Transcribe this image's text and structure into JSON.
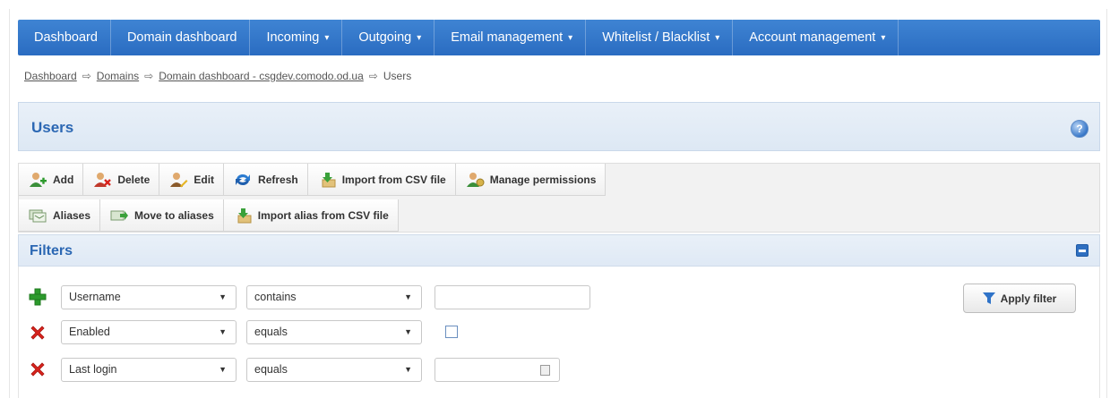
{
  "nav": {
    "items": [
      {
        "label": "Dashboard",
        "caret": ""
      },
      {
        "label": "Domain dashboard",
        "caret": ""
      },
      {
        "label": "Incoming",
        "caret": "▾"
      },
      {
        "label": "Outgoing",
        "caret": "▾"
      },
      {
        "label": "Email management",
        "caret": "▾"
      },
      {
        "label": "Whitelist / Blacklist",
        "caret": "▾"
      },
      {
        "label": "Account management",
        "caret": "▾"
      }
    ]
  },
  "breadcrumb": {
    "items": [
      "Dashboard",
      "Domains",
      "Domain dashboard - csgdev.comodo.od.ua"
    ],
    "current": "Users",
    "separator": "⇨"
  },
  "users_panel": {
    "title": "Users",
    "help_glyph": "?"
  },
  "toolbar": {
    "row1": [
      {
        "label": "Add",
        "icon": "user-add-icon"
      },
      {
        "label": "Delete",
        "icon": "user-delete-icon"
      },
      {
        "label": "Edit",
        "icon": "user-edit-icon"
      },
      {
        "label": "Refresh",
        "icon": "refresh-icon"
      },
      {
        "label": "Import from CSV file",
        "icon": "import-csv-icon"
      },
      {
        "label": "Manage permissions",
        "icon": "permissions-icon"
      }
    ],
    "row2": [
      {
        "label": "Aliases",
        "icon": "aliases-icon"
      },
      {
        "label": "Move to aliases",
        "icon": "move-to-aliases-icon"
      },
      {
        "label": "Import alias from CSV file",
        "icon": "import-alias-csv-icon"
      }
    ]
  },
  "filters": {
    "title": "Filters",
    "rows": [
      {
        "icon": "add-filter-icon",
        "field": "Username",
        "operator": "contains",
        "value_type": "text",
        "value": ""
      },
      {
        "icon": "remove-filter-icon",
        "field": "Enabled",
        "operator": "equals",
        "value_type": "checkbox",
        "value": ""
      },
      {
        "icon": "remove-filter-icon",
        "field": "Last login",
        "operator": "equals",
        "value_type": "date",
        "value": ""
      }
    ],
    "apply_label": "Apply filter"
  },
  "colors": {
    "nav_blue": "#2f73c8",
    "title_blue": "#2b67b3",
    "add_green": "#2c9a2c",
    "remove_red": "#d8231d"
  }
}
